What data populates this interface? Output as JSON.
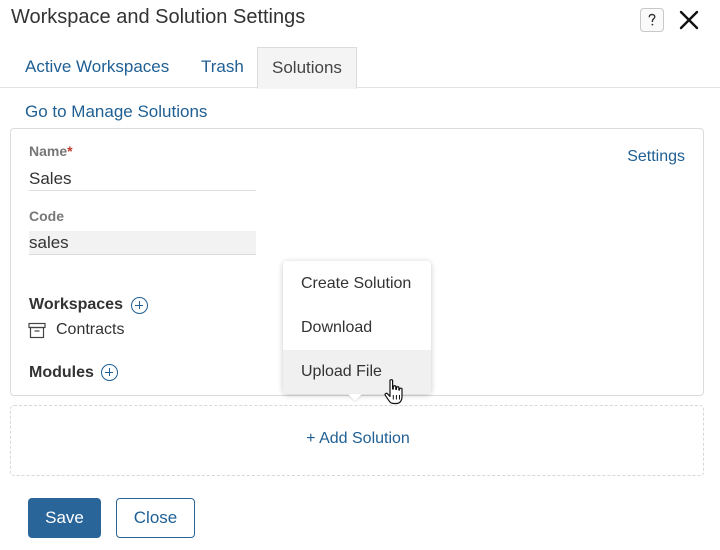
{
  "dialog": {
    "title": "Workspace and Solution Settings"
  },
  "tabs": [
    {
      "label": "Active Workspaces",
      "active": false
    },
    {
      "label": "Trash",
      "active": false
    },
    {
      "label": "Solutions",
      "active": true
    }
  ],
  "manage_link": "Go to Manage Solutions",
  "solution_card": {
    "settings_link": "Settings",
    "name": {
      "label": "Name",
      "required_mark": "*",
      "value": "Sales"
    },
    "code": {
      "label": "Code",
      "value": "sales"
    },
    "workspaces": {
      "label": "Workspaces",
      "items": [
        "Contracts"
      ]
    },
    "modules": {
      "label": "Modules"
    }
  },
  "dropdown_menu": {
    "items": [
      "Create Solution",
      "Download",
      "Upload File"
    ],
    "hovered": "Upload File"
  },
  "add_solution": "+ Add Solution",
  "footer": {
    "save_label": "Save",
    "close_label": "Close"
  },
  "colors": {
    "link": "#1f5f93",
    "primary_button": "#2a659a",
    "required": "#c0392b"
  }
}
